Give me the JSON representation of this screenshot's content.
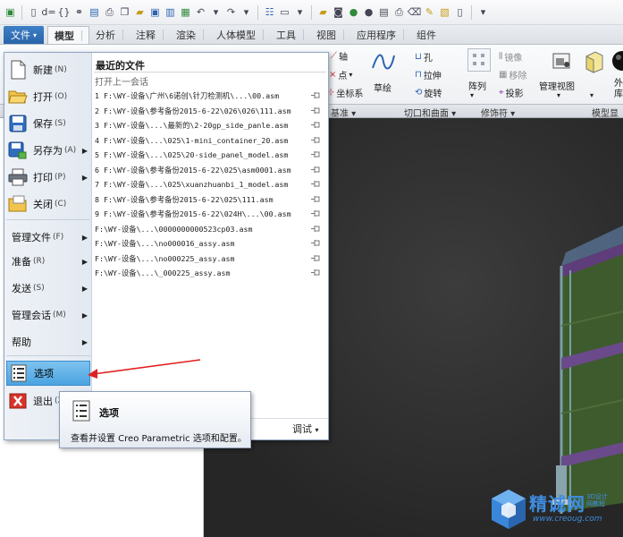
{
  "tabs": {
    "file_label": "文件",
    "items": [
      "模型",
      "分析",
      "注释",
      "渲染",
      "人体模型",
      "工具",
      "视图",
      "应用程序",
      "组件"
    ],
    "active": "模型"
  },
  "ribbon": {
    "axis": "轴",
    "point": "点",
    "csys": "坐标系",
    "sketch": "草绘",
    "hole": "孔",
    "extrude": "拉伸",
    "revolve": "旋转",
    "pattern": "阵列",
    "mirror": "镜像",
    "move": "移除",
    "project": "投影",
    "manage_views": "管理视图",
    "appearance": "外\n库",
    "group_datum": "基准",
    "group_cut": "切口和曲面",
    "group_modifier": "修饰符",
    "group_display": "模型显"
  },
  "file_menu": {
    "items": [
      {
        "label": "新建",
        "accel": "(N)",
        "icon": "new-file-icon"
      },
      {
        "label": "打开",
        "accel": "(O)",
        "icon": "open-folder-icon"
      },
      {
        "label": "保存",
        "accel": "(S)",
        "icon": "save-icon"
      },
      {
        "label": "另存为",
        "accel": "(A)",
        "icon": "save-as-icon"
      },
      {
        "label": "打印",
        "accel": "(P)",
        "icon": "print-icon"
      },
      {
        "label": "关闭",
        "accel": "(C)",
        "icon": "close-folder-icon"
      }
    ],
    "text_items": [
      {
        "label": "管理文件",
        "accel": "(F)"
      },
      {
        "label": "准备",
        "accel": "(R)"
      },
      {
        "label": "发送",
        "accel": "(S)"
      },
      {
        "label": "管理会话",
        "accel": "(M)"
      },
      {
        "label": "帮助",
        "accel": ""
      }
    ],
    "options_label": "选项",
    "exit_label": "退出",
    "exit_accel": "(X)",
    "recent_title": "最近的文件",
    "open_previous": "打开上一会话",
    "recent_files": [
      "1 F:\\WY-设备\\广州\\6诺创\\针刀检测机\\...\\00.asm",
      "2 F:\\WY-设备\\参考备份2015-6-22\\026\\026\\111.asm",
      "3 F:\\WY-设备\\...\\最新的\\2-20gp_side_panle.asm",
      "4 F:\\WY-设备\\...\\025\\1-mini_container_20.asm",
      "5 F:\\WY-设备\\...\\025\\20-side_panel_model.asm",
      "6 F:\\WY-设备\\参考备份2015-6-22\\025\\asm0001.asm",
      "7 F:\\WY-设备\\...\\025\\xuanzhuanbi_1_model.asm",
      "8 F:\\WY-设备\\参考备份2015-6-22\\025\\111.asm",
      "9 F:\\WY-设备\\参考备份2015-6-22\\024H\\...\\00.asm",
      "  F:\\WY-设备\\...\\0000000000523cp03.asm",
      "  F:\\WY-设备\\...\\no000016_assy.asm",
      "  F:\\WY-设备\\...\\no000225_assy.asm",
      "  F:\\WY-设备\\...\\_000225_assy.asm"
    ],
    "debug_label": "调试"
  },
  "tooltip": {
    "title": "选项",
    "description": "查看并设置 Creo Parametric 选项和配置。"
  },
  "watermark": {
    "name": "精诚网",
    "sub": "3D设计网教程",
    "url": "www.creoug.com"
  }
}
